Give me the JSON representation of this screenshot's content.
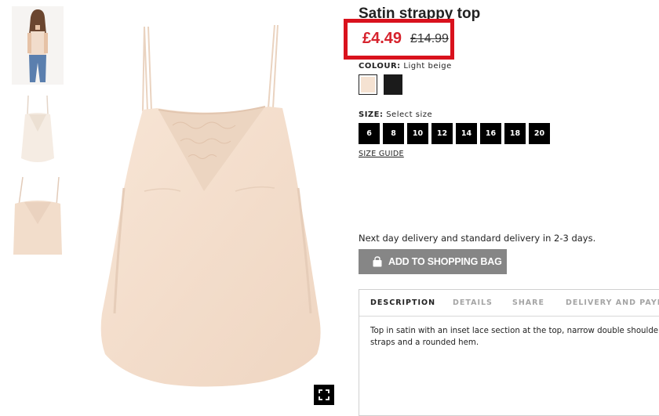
{
  "product": {
    "title": "Satin strappy top",
    "price_now": "£4.49",
    "price_was": "£14.99",
    "colour_label": "COLOUR:",
    "colour_value": "Light beige",
    "size_label": "SIZE:",
    "size_value": "Select size",
    "sizes": [
      "6",
      "8",
      "10",
      "12",
      "14",
      "16",
      "18",
      "20"
    ],
    "size_guide": "SIZE GUIDE",
    "delivery_note": "Next day delivery and standard delivery in 2-3 days.",
    "add_to_bag": "ADD TO SHOPPING BAG"
  },
  "tabs": [
    "DESCRIPTION",
    "DETAILS",
    "SHARE",
    "DELIVERY AND PAYME"
  ],
  "description": "Top in satin with an inset lace section at the top, narrow double shoulder straps and a rounded hem.",
  "colors": {
    "price_highlight": "#d9121d",
    "sale_price": "#d6232d",
    "swatch_beige": "#f5e2d2",
    "swatch_black": "#1b1b1b",
    "add_button": "#868686"
  },
  "icons": {
    "fullscreen": "fullscreen-icon",
    "bag": "shopping-bag-icon"
  }
}
